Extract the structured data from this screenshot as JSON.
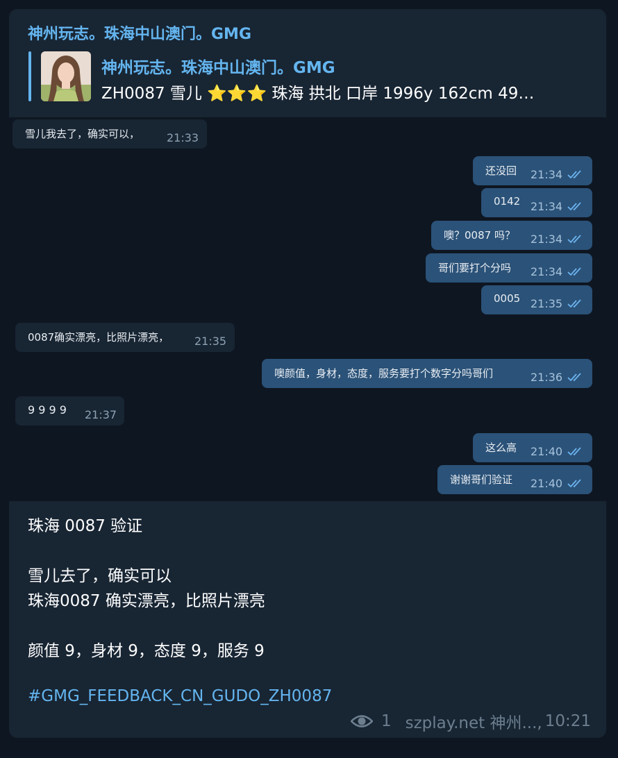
{
  "post": {
    "channel_title": "神州玩志。珠海中山澳门。GMG",
    "reply": {
      "title": "神州玩志。珠海中山澳门。GMG",
      "text": "ZH0087 雪儿 ⭐⭐⭐ 珠海 拱北 口岸 1996y  162cm  49…",
      "thumbnail_icon": "profile-photo"
    },
    "lines": {
      "heading": "珠海 0087 验证",
      "line1": "雪儿去了，确实可以",
      "line2": "珠海0087 确实漂亮，比照片漂亮",
      "line3": "颜值 9，身材 9，态度 9，服务 9",
      "hashtag": "#GMG_FEEDBACK_CN_GUDO_ZH0087"
    },
    "footer": {
      "views": "1",
      "author": "szplay.net 神州...,",
      "time": "10:21"
    }
  },
  "messages": [
    {
      "side": "in",
      "text": "雪儿我去了，确实可以，",
      "time": "21:33"
    },
    {
      "side": "out",
      "text": "还没回",
      "time": "21:34"
    },
    {
      "side": "out",
      "text": "0142",
      "time": "21:34"
    },
    {
      "side": "out",
      "text": "噢？0087 吗？",
      "time": "21:34"
    },
    {
      "side": "out",
      "text": "哥们要打个分吗",
      "time": "21:34"
    },
    {
      "side": "out",
      "text": "0005",
      "time": "21:35"
    },
    {
      "side": "in",
      "text": "0087确实漂亮，比照片漂亮，",
      "time": "21:35"
    },
    {
      "side": "out",
      "text": "噢颜值，身材，态度，服务要打个数字分吗哥们",
      "time": "21:36"
    },
    {
      "side": "in",
      "text": "9 9 9 9",
      "time": "21:37"
    },
    {
      "side": "out",
      "text": "这么高",
      "time": "21:40"
    },
    {
      "side": "out",
      "text": "谢谢哥们验证",
      "time": "21:40"
    }
  ],
  "colors": {
    "background": "#0e1621",
    "card": "#182533",
    "outgoing_bubble": "#2b5278",
    "accent": "#64b5ef"
  }
}
